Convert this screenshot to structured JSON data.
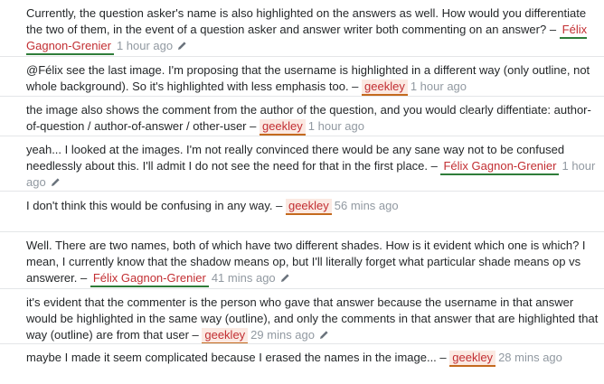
{
  "comments": [
    {
      "text": "Currently, the question asker's name is also highlighted on the answers as well. How would you differentiate the two of them, in the event of a question asker and answer writer both commenting on an answer? –",
      "user": "Félix Gagnon-Grenier",
      "user_role": "question-asker",
      "time": "1 hour ago",
      "edited": true
    },
    {
      "text": "@Félix see the last image. I'm proposing that the username is highlighted in a different way (only outline, not whole background). So it's highlighted with less emphasis too. –",
      "user": "geekley",
      "user_role": "answer-writer",
      "time": "1 hour ago",
      "edited": false
    },
    {
      "text": "the image also shows the comment from the author of the question, and you would clearly diffentiate: author-of-question / author-of-answer / other-user –",
      "user": "geekley",
      "user_role": "answer-writer",
      "time": "1 hour ago",
      "edited": false
    },
    {
      "text": "yeah... I looked at the images. I'm not really convinced there would be any sane way not to be confused needlessly about this. I'll admit I do not see the need for that in the first place. –",
      "user": "Félix Gagnon-Grenier",
      "user_role": "question-asker",
      "time": "1 hour ago",
      "edited": true
    },
    {
      "text": "I don't think this would be confusing in any way. –",
      "user": "geekley",
      "user_role": "answer-writer",
      "time": "56 mins ago",
      "edited": false
    },
    {
      "text": "Well. There are two names, both of which have two different shades. How is it evident which one is which? I mean, I currently know that the shadow means op, but I'll literally forget what particular shade means op vs answerer. –",
      "user": "Félix Gagnon-Grenier",
      "user_role": "question-asker",
      "time": "41 mins ago",
      "edited": true
    },
    {
      "text": "it's evident that the commenter is the person who gave that answer because the username in that answer would be highlighted in the same way (outline), and only the comments in that answer that are highlighted that way (outline) are from that user –",
      "user": "geekley",
      "user_role": "answer-writer",
      "time": "29 mins ago",
      "edited": true
    },
    {
      "text": "maybe I made it seem complicated because I erased the names in the image... –",
      "user": "geekley",
      "user_role": "answer-writer",
      "time": "28 mins ago",
      "edited": false
    }
  ],
  "colors": {
    "username": "#c22e32",
    "asker_underline": "#2f7d3a",
    "writer_underline": "#c46a1e",
    "writer_background": "#fbe9e2",
    "timestamp": "#9199a1",
    "divider": "#e4e6e8"
  },
  "icons": {
    "edited": "pencil-icon"
  }
}
